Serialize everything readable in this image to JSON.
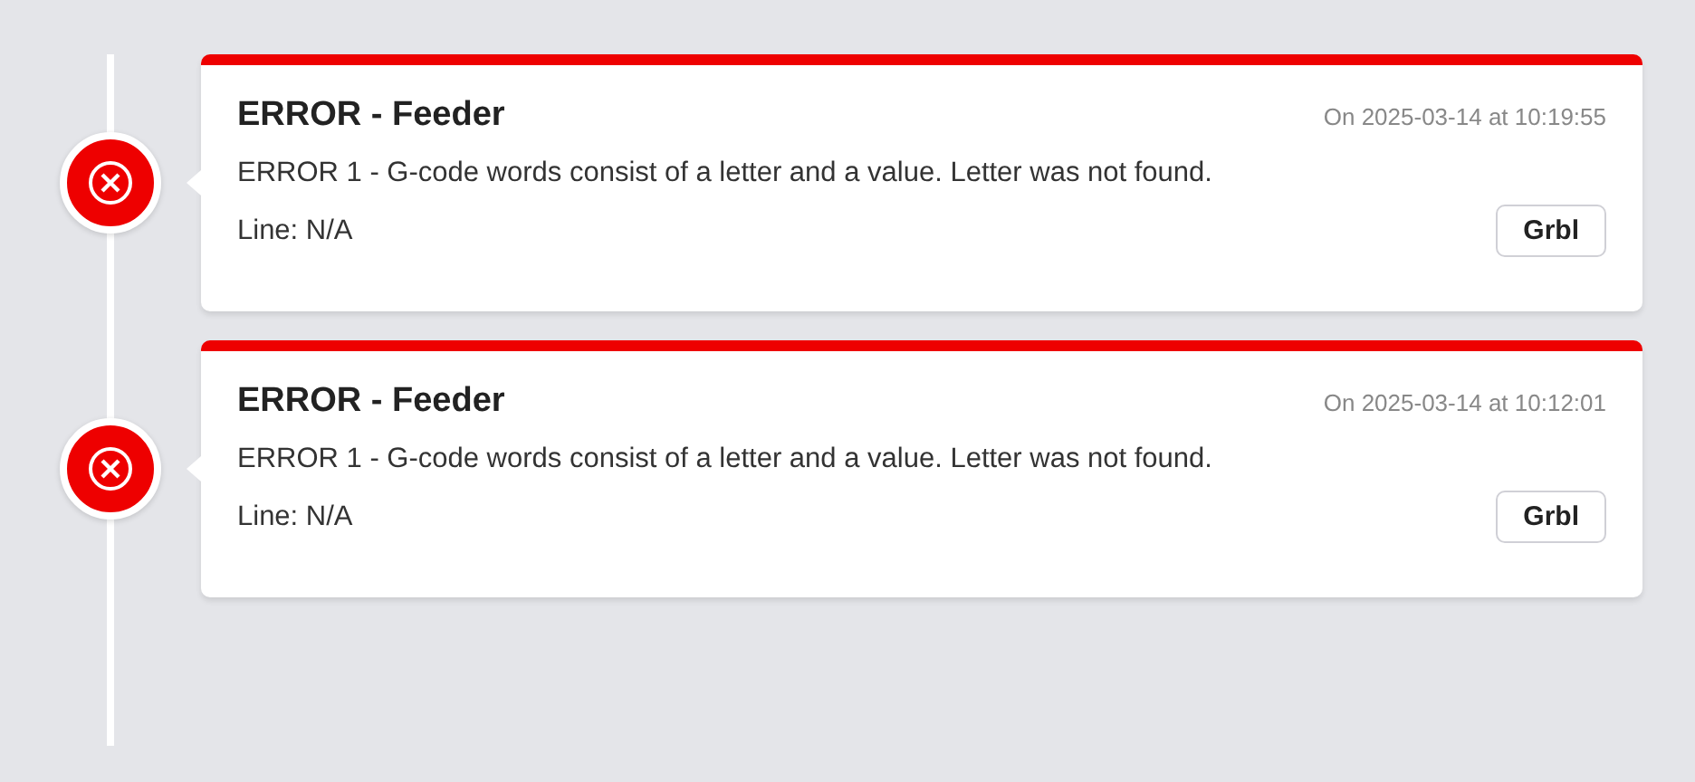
{
  "events": [
    {
      "kind": "error",
      "title": "ERROR - Feeder",
      "timestamp": "On 2025-03-14 at 10:19:55",
      "message": "ERROR 1 - G-code words consist of a letter and a value. Letter was not found.",
      "line": "Line: N/A",
      "tag": "Grbl"
    },
    {
      "kind": "error",
      "title": "ERROR - Feeder",
      "timestamp": "On 2025-03-14 at 10:12:01",
      "message": "ERROR 1 - G-code words consist of a letter and a value. Letter was not found.",
      "line": "Line: N/A",
      "tag": "Grbl"
    }
  ]
}
